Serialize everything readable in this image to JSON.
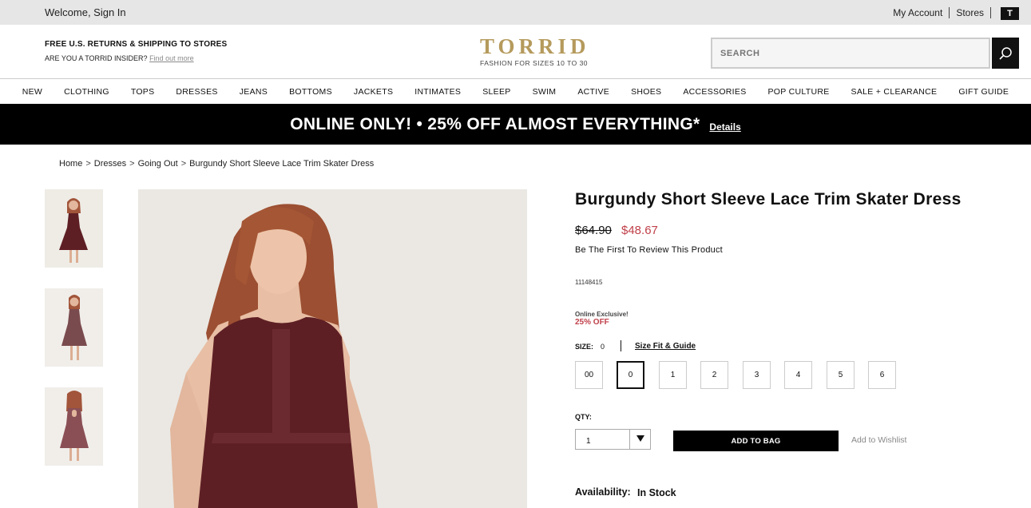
{
  "topbar": {
    "welcome": "Welcome, Sign In",
    "my_account": "My Account",
    "stores": "Stores",
    "bag_logo": "T"
  },
  "header": {
    "promo_line1": "FREE U.S. RETURNS & SHIPPING TO STORES",
    "promo_line2": "ARE YOU A TORRID INSIDER?",
    "promo_link": "Find out more",
    "logo": "TORRID",
    "tagline": "FASHION FOR SIZES 10 TO 30",
    "search_placeholder": "SEARCH"
  },
  "nav": [
    "NEW",
    "CLOTHING",
    "TOPS",
    "DRESSES",
    "JEANS",
    "BOTTOMS",
    "JACKETS",
    "INTIMATES",
    "SLEEP",
    "SWIM",
    "ACTIVE",
    "SHOES",
    "ACCESSORIES",
    "POP CULTURE",
    "SALE + CLEARANCE",
    "GIFT GUIDE"
  ],
  "banner": {
    "text": "ONLINE ONLY! •  25% OFF ALMOST EVERYTHING*",
    "details": "Details"
  },
  "breadcrumb": [
    "Home",
    "Dresses",
    "Going Out",
    "Burgundy Short Sleeve Lace Trim Skater Dress"
  ],
  "breadcrumb_sep": ">",
  "product": {
    "title": "Burgundy Short Sleeve Lace Trim Skater Dress",
    "price_old": "$64.90",
    "price_new": "$48.67",
    "review_prompt": "Be The First To Review This Product",
    "sku": "11148415",
    "online_exclusive": "Online Exclusive!",
    "discount": "25% OFF",
    "size_label": "SIZE:",
    "size_selected": "0",
    "size_guide": "Size Fit & Guide",
    "sizes": [
      "00",
      "0",
      "1",
      "2",
      "3",
      "4",
      "5",
      "6"
    ],
    "qty_label": "QTY:",
    "qty_value": "1",
    "add_to_bag": "ADD TO BAG",
    "add_to_wishlist": "Add to Wishlist",
    "availability_label": "Availability:",
    "availability_value": "In Stock"
  },
  "colors": {
    "accent_gold": "#b59a5c",
    "sale_red": "#c0404a",
    "dress_burgundy": "#5e1f24"
  }
}
